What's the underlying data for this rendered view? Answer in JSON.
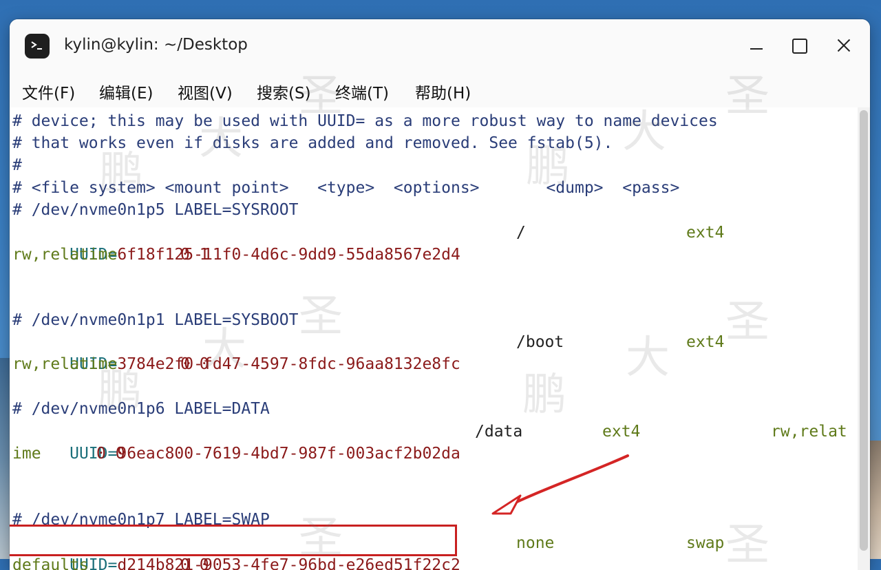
{
  "window": {
    "title": "kylin@kylin: ~/Desktop"
  },
  "menu": [
    {
      "label": "文件(F)"
    },
    {
      "label": "编辑(E)"
    },
    {
      "label": "视图(V)"
    },
    {
      "label": "搜索(S)"
    },
    {
      "label": "终端(T)"
    },
    {
      "label": "帮助(H)"
    }
  ],
  "terminal": {
    "lines": {
      "l1": "# device; this may be used with UUID= as a more robust way to name devices",
      "l2": "# that works even if disks are added and removed. See fstab(5).",
      "l3": "#",
      "l4": "# <file system> <mount point>   <type>  <options>       <dump>  <pass>",
      "l5": "# /dev/nvme0n1p5 LABEL=SYSROOT",
      "l6": {
        "key": "UUID=",
        "val": "6f18f125-11f0-4d6c-9dd9-55da8567e2d4",
        "mount": "/",
        "type": "ext4"
      },
      "l7": {
        "opts": "rw,relatime",
        "nums": "0 1"
      },
      "l9": "# /dev/nvme0n1p1 LABEL=SYSBOOT",
      "l10": {
        "key": "UUID=",
        "val": "3784e2f0-fd47-4597-8fdc-96aa8132e8fc",
        "mount": "/boot",
        "type": "ext4"
      },
      "l11": {
        "opts": "rw,relatime",
        "nums": "0 0"
      },
      "l13": "# /dev/nvme0n1p6 LABEL=DATA",
      "l14": {
        "key": "UUID=",
        "val": "96eac800-7619-4bd7-987f-003acf2b02da",
        "mount": "/data",
        "type": "ext4",
        "opts": "rw,relat"
      },
      "l15": {
        "opts": "ime",
        "nums": "0 0"
      },
      "l18": "# /dev/nvme0n1p7 LABEL=SWAP",
      "l19": {
        "key": "UUID=",
        "val": "d214b821-9053-4fe7-96bd-e26ed51f22c2",
        "mount": "none",
        "type": "swap"
      },
      "l20": {
        "opts": "defaults",
        "nums": "0 0"
      }
    }
  },
  "watermark": [
    "鹏",
    "大",
    "圣"
  ]
}
